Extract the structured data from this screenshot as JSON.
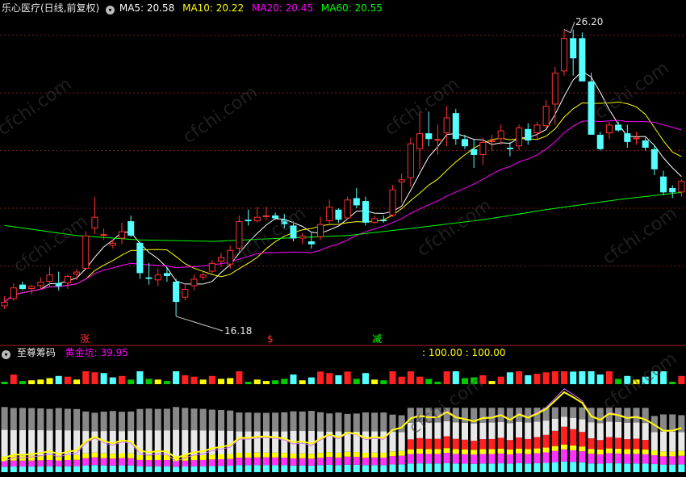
{
  "header": {
    "title": "乐心医疗(日线,前复权)",
    "ma5": "MA5: 20.58",
    "ma10": "MA10: 20.22",
    "ma20": "MA20: 20.45",
    "ma60": "MA60: 20.55"
  },
  "indicator": {
    "title": "至尊筹码",
    "line_label": "黄金坑: 39.95",
    "ref_values": ": 100.00 : 100.00"
  },
  "annotations": {
    "high": "26.20",
    "low": "16.18",
    "signal_up": "涨",
    "signal_mid": "$",
    "signal_down": "减"
  },
  "watermark": "cfchi.com",
  "colors": {
    "up": "#ff3232",
    "down": "#54ffff",
    "ma5": "#ffffff",
    "ma10": "#ffff00",
    "ma20": "#ff00ff",
    "ma60": "#00ff00",
    "grid": "#7f1f1f"
  },
  "chart_data": {
    "type": "candlestick",
    "title": "乐心医疗(日线,前复权)",
    "ylim": [
      15.8,
      27.0
    ],
    "candles": [
      [
        16.6,
        16.95,
        16.5,
        16.75
      ],
      [
        16.85,
        17.4,
        16.8,
        17.25
      ],
      [
        17.35,
        17.45,
        17.15,
        17.2
      ],
      [
        17.2,
        17.35,
        17.0,
        17.3
      ],
      [
        17.3,
        17.6,
        17.2,
        17.45
      ],
      [
        17.45,
        17.95,
        17.25,
        17.7
      ],
      [
        17.4,
        17.8,
        17.15,
        17.3
      ],
      [
        17.4,
        17.7,
        17.2,
        17.65
      ],
      [
        17.7,
        17.9,
        17.5,
        17.8
      ],
      [
        17.9,
        19.2,
        17.85,
        19.05
      ],
      [
        19.3,
        20.4,
        19.1,
        19.7
      ],
      [
        19.05,
        19.3,
        18.9,
        19.1
      ],
      [
        18.7,
        18.9,
        18.6,
        18.8
      ],
      [
        18.95,
        19.5,
        18.75,
        19.2
      ],
      [
        19.55,
        19.75,
        19.0,
        19.05
      ],
      [
        18.8,
        18.85,
        17.55,
        17.75
      ],
      [
        17.6,
        18.1,
        17.35,
        17.55
      ],
      [
        17.5,
        17.9,
        17.3,
        17.7
      ],
      [
        17.75,
        17.95,
        17.45,
        17.65
      ],
      [
        17.45,
        17.55,
        16.25,
        16.75
      ],
      [
        16.9,
        17.4,
        16.8,
        17.2
      ],
      [
        17.3,
        17.7,
        17.15,
        17.55
      ],
      [
        17.6,
        17.8,
        17.5,
        17.7
      ],
      [
        17.8,
        18.2,
        17.75,
        18.1
      ],
      [
        18.15,
        18.45,
        17.95,
        18.3
      ],
      [
        18.05,
        18.7,
        17.9,
        18.55
      ],
      [
        18.6,
        19.75,
        18.45,
        19.55
      ],
      [
        19.6,
        19.95,
        19.4,
        19.55
      ],
      [
        19.55,
        20.05,
        19.5,
        19.7
      ],
      [
        19.7,
        20.05,
        19.6,
        19.75
      ],
      [
        19.75,
        19.85,
        19.6,
        19.65
      ],
      [
        19.6,
        19.8,
        19.3,
        19.45
      ],
      [
        19.4,
        19.55,
        18.85,
        18.95
      ],
      [
        18.95,
        19.15,
        18.75,
        19.05
      ],
      [
        18.85,
        19.15,
        18.6,
        18.75
      ],
      [
        19.0,
        19.7,
        18.9,
        19.45
      ],
      [
        19.55,
        20.3,
        19.4,
        20.05
      ],
      [
        19.95,
        20.0,
        19.5,
        19.6
      ],
      [
        19.65,
        20.4,
        19.6,
        20.3
      ],
      [
        20.35,
        20.7,
        20.0,
        20.1
      ],
      [
        20.25,
        20.4,
        19.4,
        19.5
      ],
      [
        19.5,
        19.75,
        19.45,
        19.65
      ],
      [
        19.6,
        19.75,
        19.5,
        19.55
      ],
      [
        19.75,
        20.8,
        19.7,
        20.65
      ],
      [
        20.9,
        21.2,
        20.2,
        21.0
      ],
      [
        21.05,
        22.45,
        20.75,
        22.25
      ],
      [
        22.05,
        23.35,
        21.35,
        22.6
      ],
      [
        22.6,
        23.35,
        22.15,
        22.4
      ],
      [
        22.35,
        22.9,
        21.85,
        22.4
      ],
      [
        22.6,
        23.55,
        22.15,
        23.15
      ],
      [
        23.3,
        23.45,
        22.2,
        22.4
      ],
      [
        22.4,
        22.55,
        22.05,
        22.15
      ],
      [
        22.05,
        22.4,
        21.4,
        21.85
      ],
      [
        21.85,
        22.45,
        21.5,
        22.3
      ],
      [
        22.3,
        22.55,
        22.0,
        22.35
      ],
      [
        22.4,
        22.9,
        22.2,
        22.7
      ],
      [
        22.1,
        22.3,
        21.8,
        22.05
      ],
      [
        22.15,
        22.9,
        22.0,
        22.8
      ],
      [
        22.75,
        22.95,
        22.2,
        22.35
      ],
      [
        22.6,
        23.0,
        22.4,
        22.9
      ],
      [
        22.85,
        23.75,
        22.75,
        23.55
      ],
      [
        23.6,
        24.9,
        22.9,
        24.7
      ],
      [
        24.75,
        26.2,
        24.6,
        25.9
      ],
      [
        25.9,
        26.2,
        24.6,
        25.2
      ],
      [
        25.9,
        26.1,
        24.4,
        24.4
      ],
      [
        24.4,
        24.7,
        22.55,
        22.55
      ],
      [
        22.55,
        22.65,
        22.0,
        22.05
      ],
      [
        22.6,
        23.0,
        22.4,
        22.9
      ],
      [
        22.9,
        23.0,
        22.65,
        22.7
      ],
      [
        22.6,
        22.9,
        22.1,
        22.3
      ],
      [
        22.45,
        22.65,
        22.2,
        22.45
      ],
      [
        22.35,
        22.45,
        22.0,
        22.1
      ],
      [
        22.05,
        22.2,
        21.15,
        21.35
      ],
      [
        21.1,
        21.3,
        20.45,
        20.55
      ],
      [
        20.7,
        20.8,
        20.35,
        20.55
      ],
      [
        20.55,
        21.0,
        20.4,
        20.95
      ]
    ]
  }
}
